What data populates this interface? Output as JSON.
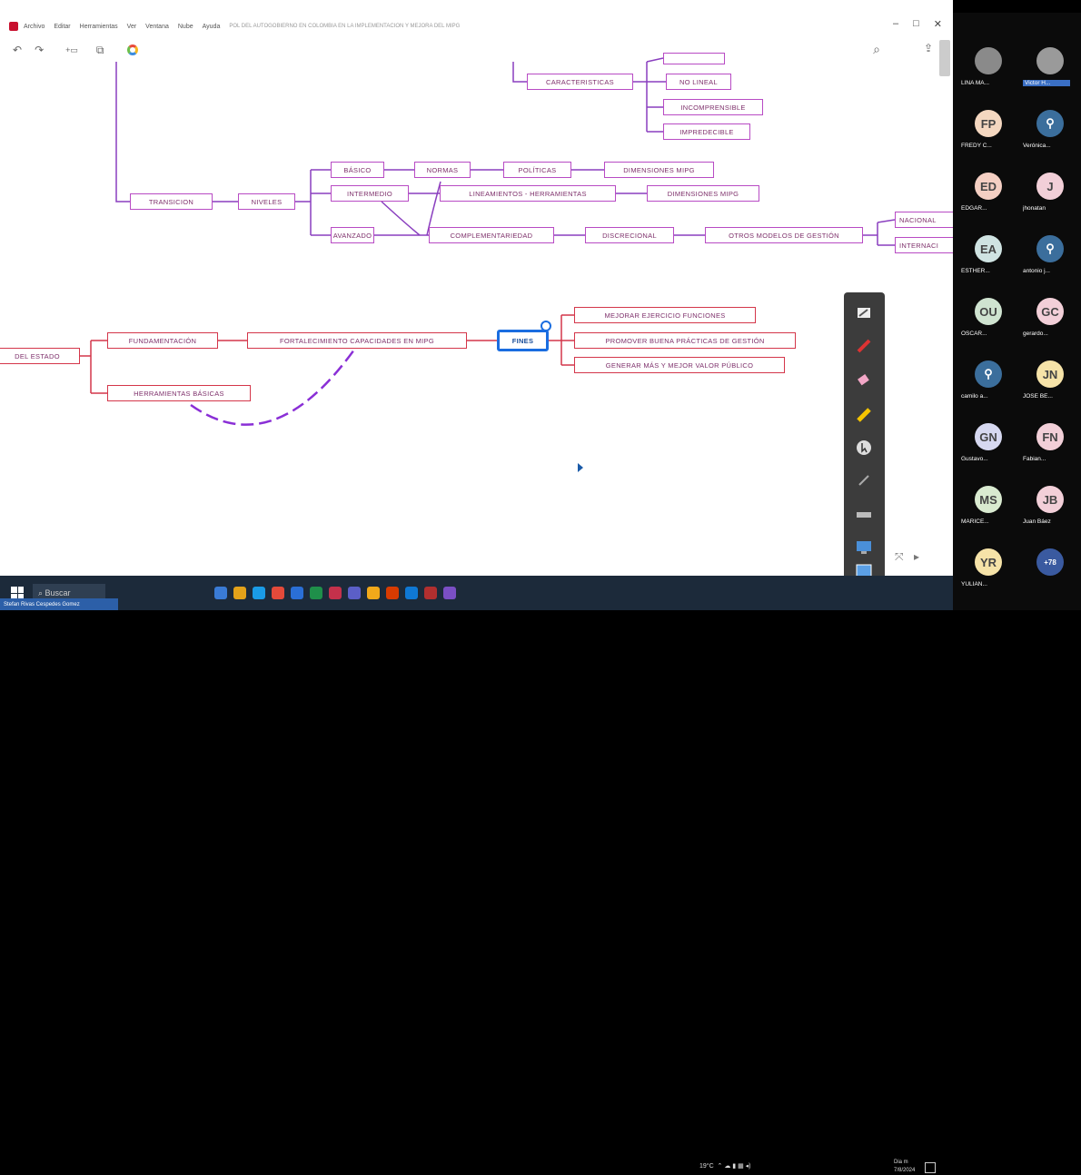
{
  "menu": {
    "items": [
      "Archivo",
      "Editar",
      "Herramientas",
      "Ver",
      "Ventana",
      "Nube",
      "Ayuda"
    ],
    "document_title": "POL DEL AUTOGOBIERNO EN COLOMBIA EN LA IMPLEMENTACION Y MEJORA DEL MIPG"
  },
  "window": {
    "minimize": "–",
    "maximize": "□",
    "close": "✕"
  },
  "toolbar": {
    "undo": "↶",
    "redo": "↷",
    "insert": "+▭",
    "copy": "⧉",
    "search": "⌕",
    "share": "⇪"
  },
  "mindmap": {
    "nodes": {
      "caracteristicas": "CARACTERISTICAS",
      "no_lineal": "NO LINEAL",
      "incomprensible": "INCOMPRENSIBLE",
      "impredecible": "IMPREDECIBLE",
      "transicion": "TRANSICION",
      "niveles": "NIVELES",
      "basico": "BÁSICO",
      "normas": "NORMAS",
      "politicas": "POLÍTICAS",
      "dimensiones_1": "DIMENSIONES MIPG",
      "intermedio": "INTERMEDIO",
      "lineamientos": "LINEAMIENTOS - HERRAMIENTAS",
      "dimensiones_2": "DIMENSIONES MIPG",
      "avanzado": "AVANZADO",
      "complementariedad": "COMPLEMENTARIEDAD",
      "discrecional": "DISCRECIONAL",
      "otros_modelos": "OTROS MODELOS DE GESTIÓN",
      "nacional": "NACIONAL",
      "internacional": "INTERNACI",
      "del_estado": "DEL ESTADO",
      "fundamentacion": "FUNDAMENTACIÓN",
      "fortalecimiento": "FORTALECIMIENTO CAPACIDADES EN MIPG",
      "fines": "FINES",
      "mejorar": "MEJORAR EJERCICIO FUNCIONES",
      "promover": "PROMOVER BUENA PRÁCTICAS DE GESTIÓN",
      "generar": "GENERAR MÁS Y MEJOR VALOR PÚBLICO",
      "herramientas_basicas": "HERRAMIENTAS BÁSICAS"
    }
  },
  "canvas_controls": {
    "fit": "⤧",
    "arrow": "▸"
  },
  "annotation_palette": {
    "tools": [
      "board-icon",
      "pen-icon",
      "eraser-icon",
      "highlighter-icon",
      "pointer-icon",
      "line-icon",
      "ruler-icon",
      "screen-icon",
      "whiteboard-icon"
    ]
  },
  "taskbar": {
    "search_placeholder": "Buscar",
    "temperature": "19°C",
    "date_time": "Dia m\n7/8/2024",
    "caption": "Stefan Rivas Cespedes Gomez"
  },
  "participants": [
    {
      "initials": "",
      "name": "LINA MA...",
      "bg": "#8a8a8a",
      "photo": true
    },
    {
      "initials": "",
      "name": "Victor H...",
      "bg": "#9a9a9a",
      "photo": true,
      "highlight": true
    },
    {
      "initials": "FP",
      "name": "FREDY C...",
      "bg": "#f4d7c0"
    },
    {
      "initials": "⚲",
      "name": "Verónica...",
      "bg": "#3b6e9c"
    },
    {
      "initials": "ED",
      "name": "EDGAR...",
      "bg": "#f4cfc3"
    },
    {
      "initials": "J",
      "name": "jhonatan",
      "bg": "#f2cfd8"
    },
    {
      "initials": "EA",
      "name": "ESTHER...",
      "bg": "#cfe3e2"
    },
    {
      "initials": "⚲",
      "name": "antonio j...",
      "bg": "#3b6e9c"
    },
    {
      "initials": "OU",
      "name": "OSCAR...",
      "bg": "#cfe3d0"
    },
    {
      "initials": "GC",
      "name": "gerardo...",
      "bg": "#f2cfd8"
    },
    {
      "initials": "⚲",
      "name": "camilo a...",
      "bg": "#3b6e9c"
    },
    {
      "initials": "JN",
      "name": "JOSE BE...",
      "bg": "#f6e3a8"
    },
    {
      "initials": "GN",
      "name": "Gustavo...",
      "bg": "#d6d8f0"
    },
    {
      "initials": "FN",
      "name": "Fabian...",
      "bg": "#f2cfd8"
    },
    {
      "initials": "MS",
      "name": "MARICE...",
      "bg": "#d9ead0"
    },
    {
      "initials": "JB",
      "name": "Juan Báez",
      "bg": "#f2cfd8"
    },
    {
      "initials": "YR",
      "name": "YULIAN...",
      "bg": "#f6e3a8"
    },
    {
      "initials": "+78",
      "name": "",
      "bg": "#3a5aa0"
    }
  ]
}
